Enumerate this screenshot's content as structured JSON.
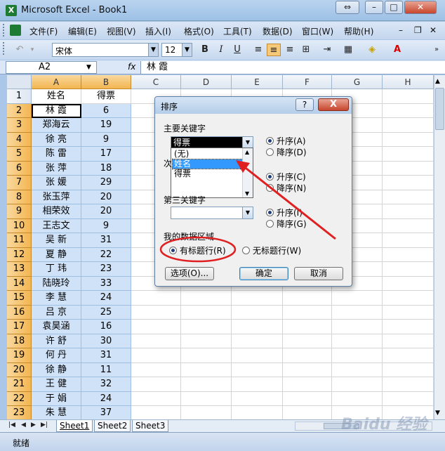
{
  "window": {
    "title": "Microsoft Excel - Book1",
    "app_icon": "X"
  },
  "menu": [
    "文件(F)",
    "编辑(E)",
    "视图(V)",
    "插入(I)",
    "格式(O)",
    "工具(T)",
    "数据(D)",
    "窗口(W)",
    "帮助(H)"
  ],
  "toolbar": {
    "font_name": "宋体",
    "font_size": "12",
    "bold": "B",
    "italic": "I",
    "underline": "U"
  },
  "formula": {
    "cell_ref": "A2",
    "fx": "fx",
    "value": "林  霞"
  },
  "columns": [
    "A",
    "B",
    "C",
    "D",
    "E",
    "F",
    "G",
    "H"
  ],
  "headers": {
    "name": "姓名",
    "votes": "得票"
  },
  "rows": [
    {
      "name": "林  霞",
      "votes": "6"
    },
    {
      "name": "郑海云",
      "votes": "19"
    },
    {
      "name": "徐  亮",
      "votes": "9"
    },
    {
      "name": "陈  雷",
      "votes": "17"
    },
    {
      "name": "张  萍",
      "votes": "18"
    },
    {
      "name": "张  媛",
      "votes": "29"
    },
    {
      "name": "张玉萍",
      "votes": "20"
    },
    {
      "name": "相荣效",
      "votes": "20"
    },
    {
      "name": "王志文",
      "votes": "9"
    },
    {
      "name": "吴  新",
      "votes": "31"
    },
    {
      "name": "夏  静",
      "votes": "22"
    },
    {
      "name": "丁  玮",
      "votes": "23"
    },
    {
      "name": "陆晓玲",
      "votes": "33"
    },
    {
      "name": "李  慧",
      "votes": "24"
    },
    {
      "name": "吕  京",
      "votes": "25"
    },
    {
      "name": "袁昊涵",
      "votes": "16"
    },
    {
      "name": "许  舒",
      "votes": "30"
    },
    {
      "name": "何  丹",
      "votes": "31"
    },
    {
      "name": "徐  静",
      "votes": "11"
    },
    {
      "name": "王  健",
      "votes": "32"
    },
    {
      "name": "于  娟",
      "votes": "24"
    },
    {
      "name": "朱  慧",
      "votes": "37"
    }
  ],
  "sheet_tabs": [
    "Sheet1",
    "Sheet2",
    "Sheet3"
  ],
  "status": "就绪",
  "dialog": {
    "title": "排序",
    "help": "?",
    "close": "X",
    "primary_key_label": "主要关键字",
    "primary_key_value": "得票",
    "list_options": [
      "(无)",
      "姓名",
      "得票"
    ],
    "selected_option": "姓名",
    "secondary_key_label": "次",
    "tertiary_key_label": "第三关键字",
    "asc": [
      "升序(A)",
      "升序(C)",
      "升序(I)"
    ],
    "desc": [
      "降序(D)",
      "降序(N)",
      "降序(G)"
    ],
    "data_region_label": "我的数据区域",
    "has_header": "有标题行(R)",
    "no_header": "无标题行(W)",
    "options_btn": "选项(O)...",
    "ok_btn": "确定",
    "cancel_btn": "取消"
  },
  "watermark": "Baidu 经验",
  "colors": {
    "accent": "#f3b550",
    "annotation": "#e02020",
    "selection": "#cfe2f7"
  }
}
